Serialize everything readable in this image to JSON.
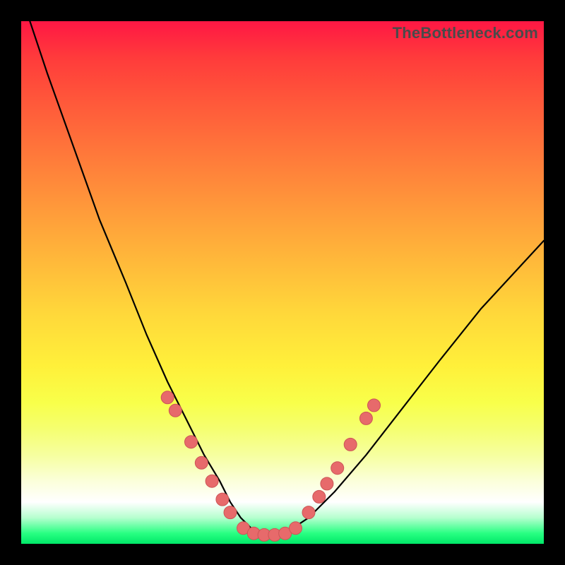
{
  "watermark": "TheBottleneck.com",
  "colors": {
    "frame": "#000000",
    "curve": "#000000",
    "marker_fill": "#e76a6b",
    "marker_stroke": "#cc5556",
    "gradient": [
      "#ff1744",
      "#ff3b3b",
      "#ff5a3a",
      "#ff7a3a",
      "#ff9a3a",
      "#ffb93a",
      "#ffd83a",
      "#fff03a",
      "#f8ff4a",
      "#f5ff70",
      "#f6ff9f",
      "#fbffda",
      "#ffffff",
      "#b6ffcf",
      "#28ff82",
      "#00e868"
    ]
  },
  "chart_data": {
    "type": "line",
    "title": "",
    "xlabel": "",
    "ylabel": "",
    "xlim": [
      0,
      100
    ],
    "ylim": [
      0,
      100
    ],
    "grid": false,
    "legend": false,
    "series": [
      {
        "name": "bottleneck-curve",
        "x": [
          0,
          5,
          10,
          15,
          20,
          24,
          28,
          32,
          35,
          38,
          40,
          42,
          44,
          46,
          48,
          50,
          52,
          55,
          60,
          66,
          73,
          80,
          88,
          100
        ],
        "y": [
          105,
          90,
          76,
          62,
          50,
          40,
          31,
          23,
          17,
          12,
          8,
          5,
          3,
          2,
          2,
          2,
          3,
          5,
          10,
          17,
          26,
          35,
          45,
          58
        ]
      }
    ],
    "markers": {
      "left": [
        {
          "x": 28.0,
          "y": 28.0
        },
        {
          "x": 29.5,
          "y": 25.5
        },
        {
          "x": 32.5,
          "y": 19.5
        },
        {
          "x": 34.5,
          "y": 15.5
        },
        {
          "x": 36.5,
          "y": 12.0
        },
        {
          "x": 38.5,
          "y": 8.5
        },
        {
          "x": 40.0,
          "y": 6.0
        }
      ],
      "bottom": [
        {
          "x": 42.5,
          "y": 3.0
        },
        {
          "x": 44.5,
          "y": 2.0
        },
        {
          "x": 46.5,
          "y": 1.7
        },
        {
          "x": 48.5,
          "y": 1.7
        },
        {
          "x": 50.5,
          "y": 2.0
        },
        {
          "x": 52.5,
          "y": 3.0
        }
      ],
      "right": [
        {
          "x": 55.0,
          "y": 6.0
        },
        {
          "x": 57.0,
          "y": 9.0
        },
        {
          "x": 58.5,
          "y": 11.5
        },
        {
          "x": 60.5,
          "y": 14.5
        },
        {
          "x": 63.0,
          "y": 19.0
        },
        {
          "x": 66.0,
          "y": 24.0
        },
        {
          "x": 67.5,
          "y": 26.5
        }
      ]
    }
  }
}
